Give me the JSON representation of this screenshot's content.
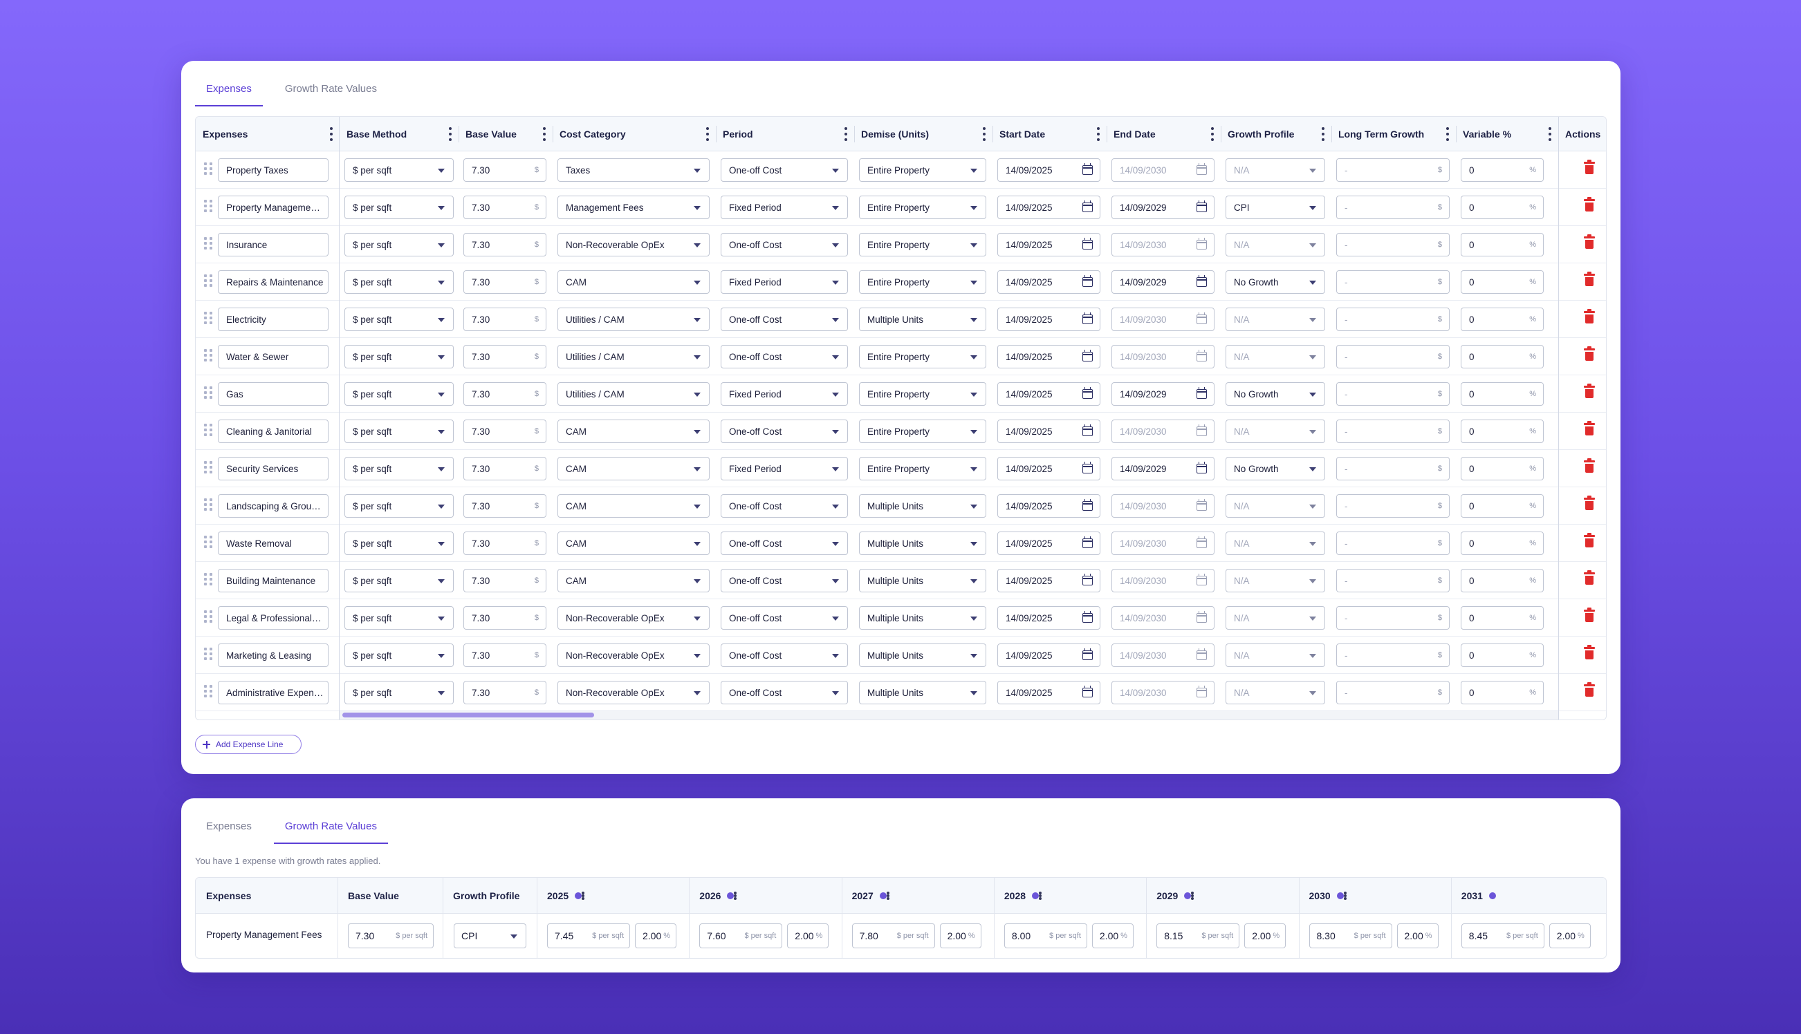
{
  "tabs": {
    "expenses": "Expenses",
    "growth": "Growth Rate Values"
  },
  "columns": {
    "expenses": "Expenses",
    "base_method": "Base Method",
    "base_value": "Base Value",
    "cost_category": "Cost Category",
    "period": "Period",
    "demise": "Demise (Units)",
    "start_date": "Start Date",
    "end_date": "End Date",
    "growth_profile": "Growth Profile",
    "long_term_growth": "Long Term Growth",
    "variable_pct": "Variable %",
    "actions": "Actions"
  },
  "units": {
    "dollar": "$",
    "percent": "%",
    "per_sqft": "$ per sqft"
  },
  "rows": [
    {
      "name": "Property Taxes",
      "method": "$ per sqft",
      "value": "7.30",
      "category": "Taxes",
      "period": "One-off Cost",
      "demise": "Entire Property",
      "start": "14/09/2025",
      "end": "14/09/2030",
      "end_active": false,
      "growth": "N/A",
      "growth_active": false,
      "ltg": "-",
      "variable": "0"
    },
    {
      "name": "Property Management Fees",
      "method": "$ per sqft",
      "value": "7.30",
      "category": "Management Fees",
      "period": "Fixed Period",
      "demise": "Entire Property",
      "start": "14/09/2025",
      "end": "14/09/2029",
      "end_active": true,
      "growth": "CPI",
      "growth_active": true,
      "ltg": "-",
      "variable": "0"
    },
    {
      "name": "Insurance",
      "method": "$ per sqft",
      "value": "7.30",
      "category": "Non-Recoverable OpEx",
      "period": "One-off Cost",
      "demise": "Entire Property",
      "start": "14/09/2025",
      "end": "14/09/2030",
      "end_active": false,
      "growth": "N/A",
      "growth_active": false,
      "ltg": "-",
      "variable": "0"
    },
    {
      "name": "Repairs & Maintenance",
      "method": "$ per sqft",
      "value": "7.30",
      "category": "CAM",
      "period": "Fixed Period",
      "demise": "Entire Property",
      "start": "14/09/2025",
      "end": "14/09/2029",
      "end_active": true,
      "growth": "No Growth",
      "growth_active": true,
      "ltg": "-",
      "variable": "0"
    },
    {
      "name": "Electricity",
      "method": "$ per sqft",
      "value": "7.30",
      "category": "Utilities / CAM",
      "period": "One-off Cost",
      "demise": "Multiple Units",
      "start": "14/09/2025",
      "end": "14/09/2030",
      "end_active": false,
      "growth": "N/A",
      "growth_active": false,
      "ltg": "-",
      "variable": "0"
    },
    {
      "name": "Water & Sewer",
      "method": "$ per sqft",
      "value": "7.30",
      "category": "Utilities / CAM",
      "period": "One-off Cost",
      "demise": "Entire Property",
      "start": "14/09/2025",
      "end": "14/09/2030",
      "end_active": false,
      "growth": "N/A",
      "growth_active": false,
      "ltg": "-",
      "variable": "0"
    },
    {
      "name": "Gas",
      "method": "$ per sqft",
      "value": "7.30",
      "category": "Utilities / CAM",
      "period": "Fixed Period",
      "demise": "Entire Property",
      "start": "14/09/2025",
      "end": "14/09/2029",
      "end_active": true,
      "growth": "No Growth",
      "growth_active": true,
      "ltg": "-",
      "variable": "0"
    },
    {
      "name": "Cleaning & Janitorial",
      "method": "$ per sqft",
      "value": "7.30",
      "category": "CAM",
      "period": "One-off Cost",
      "demise": "Entire Property",
      "start": "14/09/2025",
      "end": "14/09/2030",
      "end_active": false,
      "growth": "N/A",
      "growth_active": false,
      "ltg": "-",
      "variable": "0"
    },
    {
      "name": "Security Services",
      "method": "$ per sqft",
      "value": "7.30",
      "category": "CAM",
      "period": "Fixed Period",
      "demise": "Entire Property",
      "start": "14/09/2025",
      "end": "14/09/2029",
      "end_active": true,
      "growth": "No Growth",
      "growth_active": true,
      "ltg": "-",
      "variable": "0"
    },
    {
      "name": "Landscaping & Grounds",
      "method": "$ per sqft",
      "value": "7.30",
      "category": "CAM",
      "period": "One-off Cost",
      "demise": "Multiple Units",
      "start": "14/09/2025",
      "end": "14/09/2030",
      "end_active": false,
      "growth": "N/A",
      "growth_active": false,
      "ltg": "-",
      "variable": "0"
    },
    {
      "name": "Waste Removal",
      "method": "$ per sqft",
      "value": "7.30",
      "category": "CAM",
      "period": "One-off Cost",
      "demise": "Multiple Units",
      "start": "14/09/2025",
      "end": "14/09/2030",
      "end_active": false,
      "growth": "N/A",
      "growth_active": false,
      "ltg": "-",
      "variable": "0"
    },
    {
      "name": "Building Maintenance",
      "method": "$ per sqft",
      "value": "7.30",
      "category": "CAM",
      "period": "One-off Cost",
      "demise": "Multiple Units",
      "start": "14/09/2025",
      "end": "14/09/2030",
      "end_active": false,
      "growth": "N/A",
      "growth_active": false,
      "ltg": "-",
      "variable": "0"
    },
    {
      "name": "Legal & Professional Fees",
      "method": "$ per sqft",
      "value": "7.30",
      "category": "Non-Recoverable OpEx",
      "period": "One-off Cost",
      "demise": "Multiple Units",
      "start": "14/09/2025",
      "end": "14/09/2030",
      "end_active": false,
      "growth": "N/A",
      "growth_active": false,
      "ltg": "-",
      "variable": "0"
    },
    {
      "name": "Marketing & Leasing",
      "method": "$ per sqft",
      "value": "7.30",
      "category": "Non-Recoverable OpEx",
      "period": "One-off Cost",
      "demise": "Multiple Units",
      "start": "14/09/2025",
      "end": "14/09/2030",
      "end_active": false,
      "growth": "N/A",
      "growth_active": false,
      "ltg": "-",
      "variable": "0"
    },
    {
      "name": "Administrative Expenses",
      "method": "$ per sqft",
      "value": "7.30",
      "category": "Non-Recoverable OpEx",
      "period": "One-off Cost",
      "demise": "Multiple Units",
      "start": "14/09/2025",
      "end": "14/09/2030",
      "end_active": false,
      "growth": "N/A",
      "growth_active": false,
      "ltg": "-",
      "variable": "0"
    }
  ],
  "add_button": "Add Expense Line",
  "growth_card": {
    "info": "You have 1 expense with growth rates applied.",
    "headers": {
      "expenses": "Expenses",
      "base_value": "Base Value",
      "growth_profile": "Growth Profile"
    },
    "years": [
      "2025",
      "2026",
      "2027",
      "2028",
      "2029",
      "2030",
      "2031"
    ],
    "row": {
      "name": "Property Management Fees",
      "base_value": "7.30",
      "profile": "CPI",
      "values": [
        "7.45",
        "7.60",
        "7.80",
        "8.00",
        "8.15",
        "8.30",
        "8.45"
      ],
      "rates": [
        "2.00",
        "2.00",
        "2.00",
        "2.00",
        "2.00",
        "2.00",
        "2.00"
      ]
    }
  },
  "colors": {
    "accent": "#5b3fd6",
    "danger": "#e12b2b",
    "background_top": "#8468fb",
    "background_bottom": "#4a2fb6"
  }
}
